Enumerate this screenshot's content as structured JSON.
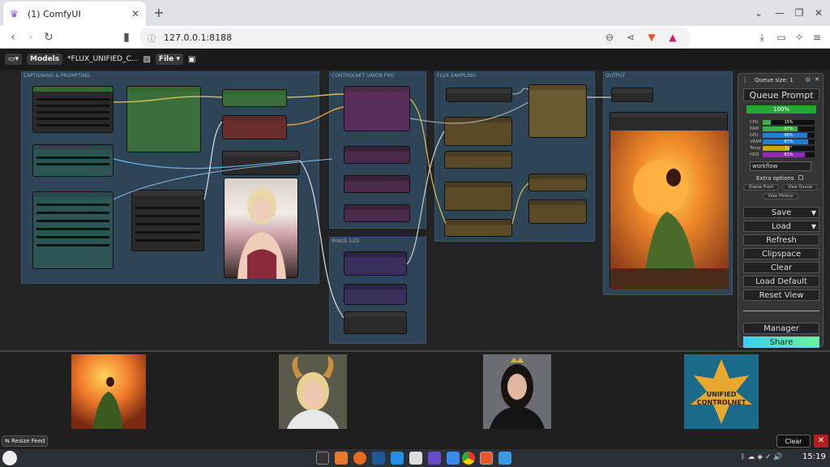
{
  "browser": {
    "tab_title": "(1) ComfyUI",
    "url": "127.0.0.1:8188"
  },
  "comfy": {
    "menu": {
      "models_label": "Models",
      "workflow_title": "*FLUX_UNIFIED_C...",
      "file_label": "File"
    },
    "groups": [
      {
        "title": "CAPTIONING & PROMPTING"
      },
      {
        "title": "CONTROLNET UNION PRO"
      },
      {
        "title": "FLUX SAMPLING"
      },
      {
        "title": "OUTPUT"
      },
      {
        "title": "IMAGE SIZE"
      }
    ],
    "panel": {
      "queue_size": "Queue size: 1",
      "queue_prompt": "Queue Prompt",
      "progress": "100%",
      "progress_value": 1.0,
      "stats": [
        {
          "label": "CPU",
          "value": "15%",
          "fraction": 0.15,
          "color": "#3cb043"
        },
        {
          "label": "RAM",
          "value": "67%",
          "fraction": 0.67,
          "color": "#3cb043"
        },
        {
          "label": "GPU",
          "value": "86%",
          "fraction": 0.86,
          "color": "#1e7fd8"
        },
        {
          "label": "VRAM",
          "value": "87%",
          "fraction": 0.87,
          "color": "#1e7fd8"
        },
        {
          "label": "Temp",
          "value": "51°",
          "fraction": 0.51,
          "color": "#c9a50e"
        },
        {
          "label": "HDD",
          "value": "81%",
          "fraction": 0.81,
          "color": "#8e2bb8"
        }
      ],
      "workflow_input": "workflow",
      "extra_options": "Extra options",
      "queue_front": "Queue Front",
      "view_queue": "View Queue",
      "view_history": "View History",
      "save": "Save",
      "load": "Load",
      "refresh": "Refresh",
      "clipspace": "Clipspace",
      "clear": "Clear",
      "load_default": "Load Default",
      "reset_view": "Reset View",
      "manager": "Manager",
      "share": "Share"
    },
    "feed": {
      "resize_label": "Resize Feed",
      "clear_label": "Clear"
    }
  },
  "taskbar": {
    "clock": "15:19"
  },
  "colors": {
    "accent_green": "#1faa33",
    "share_gradient_start": "#3bd0f0",
    "share_gradient_end": "#6cf29a",
    "group_bg": "#2e4457"
  }
}
